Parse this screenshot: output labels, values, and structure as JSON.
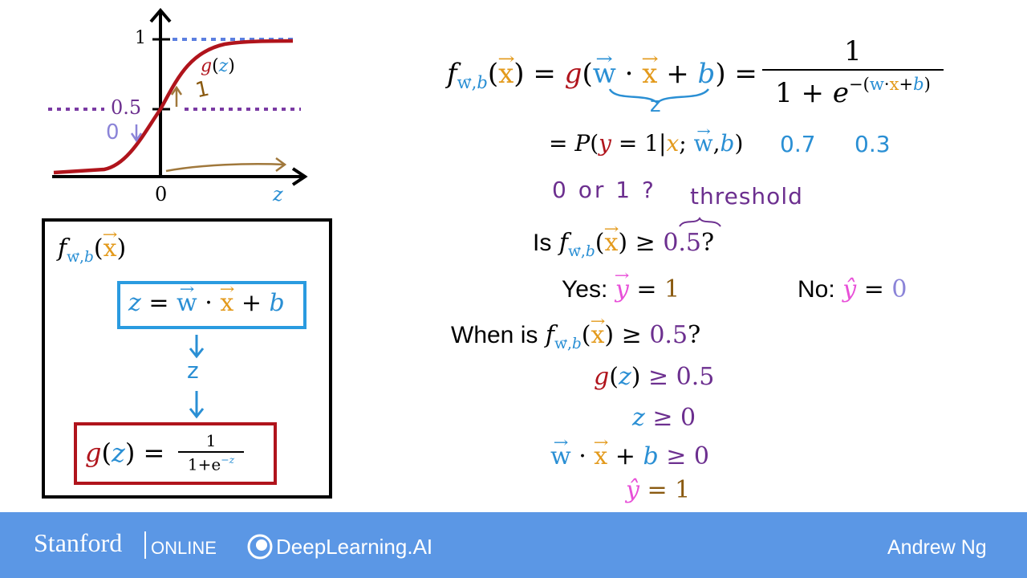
{
  "graph": {
    "tick_one": "1",
    "tick_half": "0.5",
    "origin": "0",
    "z_label": "z",
    "curve_label_g": "g",
    "curve_label_z": "z",
    "annot_one": "1",
    "annot_zero": "0"
  },
  "pipeline": {
    "f_label": "f",
    "f_sub": "w→,b",
    "f_arg": "x",
    "z_eq": {
      "z": "z",
      "eq": "=",
      "w": "w",
      "dot": "·",
      "x": "x",
      "plus": "+",
      "b": "b"
    },
    "z_mid": "z",
    "g_eq": {
      "g": "g",
      "z": "z",
      "eq": "=",
      "num": "1",
      "den": "1+e",
      "exp": "−z"
    }
  },
  "right": {
    "hand_z": "z",
    "line2_prob": "= P(y = 1|x; w, b)",
    "val_07": "0.7",
    "val_03": "0.3",
    "zero_or_one": "0 or 1 ?",
    "threshold": "threshold",
    "is_text": "Is",
    "geq_half": "≥ 0.5?",
    "half": "0.5",
    "yes": "Yes:",
    "yes_val": "1",
    "no": "No:",
    "no_val": "0",
    "when_is": "When is",
    "g_geq": "≥ 0.5",
    "z_geq": "≥ 0",
    "w_geq": "≥ 0",
    "yhat_eq": "= 1"
  },
  "footer": {
    "stanford": "Stanford",
    "online": "ONLINE",
    "deeplearning": "DeepLearning.AI",
    "author": "Andrew Ng"
  },
  "colors": {
    "footer_bg": "#5b97e5",
    "curve": "#b0141c",
    "blue": "#2a8fd4",
    "orange": "#e39a1c",
    "purple": "#6c2f8f",
    "pink": "#e84fd8"
  }
}
